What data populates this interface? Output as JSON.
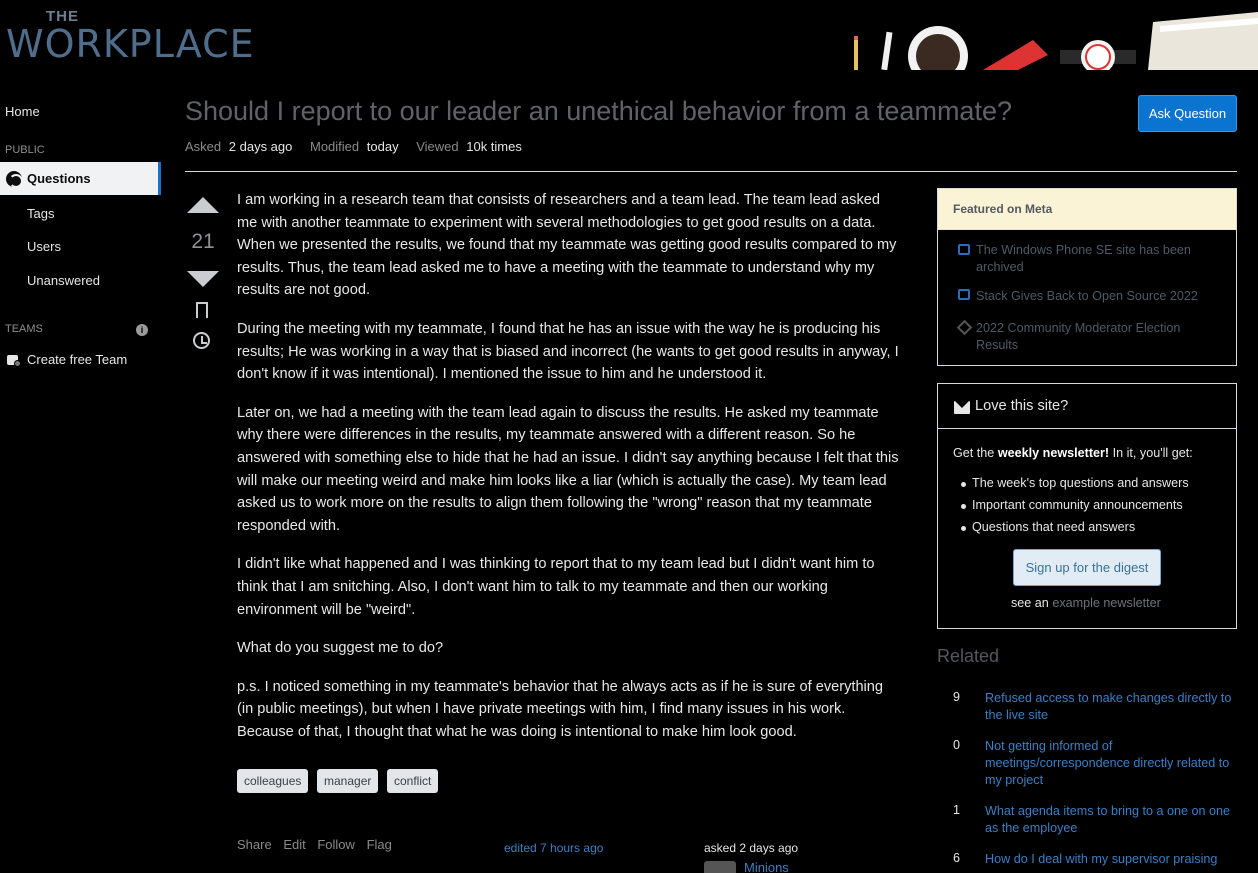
{
  "site": {
    "logo_top": "THE",
    "logo_main": "WORKPLACE",
    "colors": {
      "accent": "#0a74d0",
      "link": "#3d7fc4",
      "featured_bg": "#fbf3d5",
      "background": "#000000"
    }
  },
  "nav": {
    "home": "Home",
    "public_heading": "PUBLIC",
    "questions": "Questions",
    "tags": "Tags",
    "users": "Users",
    "unanswered": "Unanswered",
    "teams_heading": "TEAMS",
    "info_icon": "i",
    "create_team": "Create free Team"
  },
  "question": {
    "title": "Should I report to our leader an unethical behavior from a teammate?",
    "ask_button": "Ask Question",
    "asked_label": "Asked",
    "asked_value": "2 days ago",
    "modified_label": "Modified",
    "modified_value": "today",
    "viewed_label": "Viewed",
    "viewed_value": "10k times",
    "score": "21",
    "paragraphs": [
      "I am working in a research team that consists of researchers and a team lead. The team lead asked me with another teammate to experiment with several methodologies to get good results on a data. When we presented the results, we found that my teammate was getting good results compared to my results. Thus, the team lead asked me to have a meeting with the teammate to understand why my results are not good.",
      "During the meeting with my teammate, I found that he has an issue with the way he is producing his results; He was working in a way that is biased and incorrect (he wants to get good results in anyway, I don't know if it was intentional). I mentioned the issue to him and he understood it.",
      "Later on, we had a meeting with the team lead again to discuss the results. He asked my teammate why there were differences in the results, my teammate answered with a different reason. So he answered with something else to hide that he had an issue. I didn't say anything because I felt that this will make our meeting weird and make him looks like a liar (which is actually the case). My team lead asked us to work more on the results to align them following the \"wrong\" reason that my teammate responded with.",
      "I didn't like what happened and I was thinking to report that to my team lead but I didn't want him to think that I am snitching. Also, I don't want him to talk to my teammate and then our working environment will be \"weird\".",
      "What do you suggest me to do?",
      "p.s. I noticed something in my teammate's behavior that he always acts as if he is sure of everything (in public meetings), but when I have private meetings with him, I find many issues in his work. Because of that, I thought that what he was doing is intentional to make him look good."
    ],
    "tags": [
      "colleagues",
      "manager",
      "conflict"
    ],
    "menu": {
      "share": "Share",
      "edit": "Edit",
      "follow": "Follow",
      "flag": "Flag"
    },
    "edited": "edited 7 hours ago",
    "asked_card": "asked 2 days ago",
    "author": "Minions"
  },
  "featured": {
    "heading": "Featured on Meta",
    "items": [
      {
        "text": "The Windows Phone SE site has been archived",
        "icon": "chat-bubble-icon"
      },
      {
        "text": "Stack Gives Back to Open Source 2022",
        "icon": "chat-bubble-icon"
      },
      {
        "text": "2022 Community Moderator Election Results",
        "icon": "diamond-icon"
      }
    ]
  },
  "newsletter": {
    "heading": "Love this site?",
    "intro_pre": "Get the ",
    "intro_bold": "weekly newsletter!",
    "intro_post": " In it, you'll get:",
    "items": [
      "The week's top questions and answers",
      "Important community announcements",
      "Questions that need answers"
    ],
    "button": "Sign up for the digest",
    "see_an": "see an",
    "example_link": "example newsletter"
  },
  "related": {
    "heading": "Related",
    "items": [
      {
        "score": "9",
        "title": "Refused access to make changes directly to the live site"
      },
      {
        "score": "0",
        "title": "Not getting informed of meetings/correspondence directly related to my project"
      },
      {
        "score": "1",
        "title": "What agenda items to bring to a one on one as the employee"
      },
      {
        "score": "6",
        "title": "How do I deal with my supervisor praising"
      }
    ]
  }
}
